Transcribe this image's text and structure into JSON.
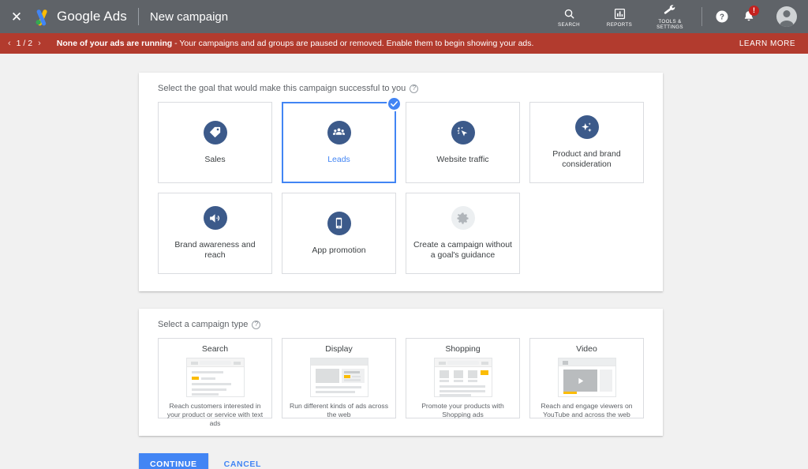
{
  "topbar": {
    "close_icon": "close-icon",
    "logo_icon": "google-ads-logo",
    "brand": "Google Ads",
    "page_title": "New campaign",
    "tools": [
      {
        "label": "SEARCH",
        "icon": "search-icon"
      },
      {
        "label": "REPORTS",
        "icon": "reports-bar-chart-icon"
      },
      {
        "label": "TOOLS &\nSETTINGS",
        "icon": "wrench-icon"
      }
    ],
    "help_icon": "help-circle-icon",
    "notifications_icon": "bell-icon",
    "notifications_badge": "!",
    "avatar_icon": "account-avatar-icon"
  },
  "banner": {
    "prev_icon": "chevron-left-icon",
    "next_icon": "chevron-right-icon",
    "counter": "1 / 2",
    "headline": "None of your ads are running",
    "detail": " - Your campaigns and ad groups are paused or removed. Enable them to begin showing your ads.",
    "learn_more": "LEARN MORE",
    "color": "#b23b2e"
  },
  "goal_section": {
    "heading": "Select the goal that would make this campaign successful to you",
    "help_icon": "help-circle-icon",
    "goals": [
      {
        "label": "Sales",
        "icon": "price-tag-icon",
        "selected": false
      },
      {
        "label": "Leads",
        "icon": "people-group-icon",
        "selected": true
      },
      {
        "label": "Website traffic",
        "icon": "cursor-click-icon",
        "selected": false
      },
      {
        "label": "Product and brand consideration",
        "icon": "sparkle-icon",
        "selected": false
      },
      {
        "label": "Brand awareness and reach",
        "icon": "speaker-icon",
        "selected": false
      },
      {
        "label": "App promotion",
        "icon": "mobile-phone-icon",
        "selected": false
      },
      {
        "label": "Create a campaign without a goal's guidance",
        "icon": "gear-icon",
        "selected": false
      }
    ],
    "selected_check_icon": "check-circle-icon",
    "accent_color": "#4285f4",
    "icon_color": "#3c5a8a"
  },
  "type_section": {
    "heading": "Select a campaign type",
    "help_icon": "help-circle-icon",
    "types": [
      {
        "title": "Search",
        "art": "search-results-mock",
        "desc": "Reach customers interested in your product or service with text ads"
      },
      {
        "title": "Display",
        "art": "display-banner-mock",
        "desc": "Run different kinds of ads across the web"
      },
      {
        "title": "Shopping",
        "art": "shopping-grid-mock",
        "desc": "Promote your products with Shopping ads"
      },
      {
        "title": "Video",
        "art": "video-player-mock",
        "desc": "Reach and engage viewers on YouTube and across the web"
      }
    ]
  },
  "actions": {
    "continue_label": "CONTINUE",
    "cancel_label": "CANCEL"
  }
}
